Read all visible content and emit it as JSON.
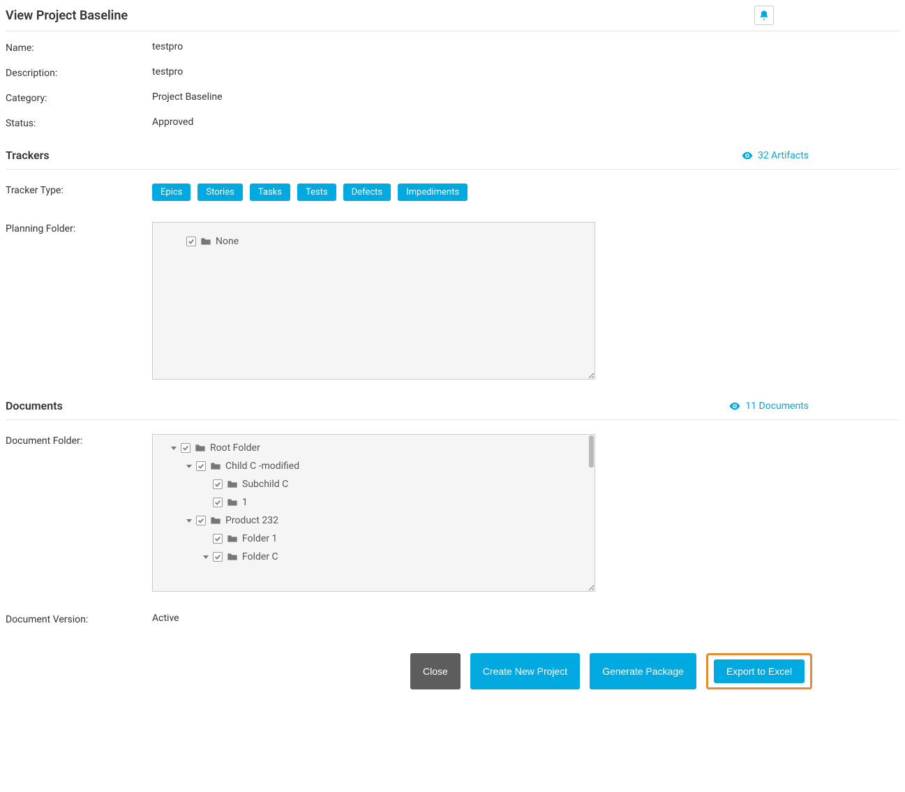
{
  "header": {
    "title": "View Project Baseline"
  },
  "details": {
    "name_label": "Name:",
    "name_value": "testpro",
    "description_label": "Description:",
    "description_value": "testpro",
    "category_label": "Category:",
    "category_value": "Project Baseline",
    "status_label": "Status:",
    "status_value": "Approved"
  },
  "trackers": {
    "title": "Trackers",
    "artifacts_link": "32 Artifacts",
    "type_label": "Tracker Type:",
    "tags": [
      "Epics",
      "Stories",
      "Tasks",
      "Tests",
      "Defects",
      "Impediments"
    ],
    "planning_label": "Planning Folder:",
    "planning_tree": [
      {
        "label": "None"
      }
    ]
  },
  "documents": {
    "title": "Documents",
    "docs_link": "11 Documents",
    "folder_label": "Document Folder:",
    "tree": {
      "root": "Root Folder",
      "childC": "Child C -modified",
      "subchildC": "Subchild C",
      "one": "1",
      "product": "Product 232",
      "folder1": "Folder 1",
      "folderC": "Folder C"
    },
    "version_label": "Document Version:",
    "version_value": "Active"
  },
  "buttons": {
    "close": "Close",
    "create": "Create New Project",
    "generate": "Generate Package",
    "export": "Export to Excel"
  }
}
